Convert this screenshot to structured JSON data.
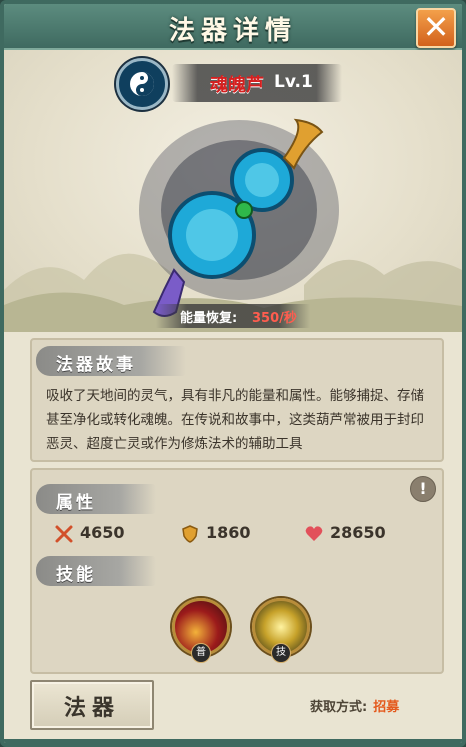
{
  "window": {
    "title": "法器详情",
    "close_icon": "close-icon"
  },
  "item": {
    "name": "魂魄芦",
    "level": "Lv.1",
    "emblem_icon": "yin-yang-icon"
  },
  "energy": {
    "label": "能量恢复:",
    "value": "350/秒"
  },
  "story": {
    "heading": "法器故事",
    "text": "吸收了天地间的灵气，具有非凡的能量和属性。能够捕捉、存储甚至净化或转化魂魄。在传说和故事中，这类葫芦常被用于封印恶灵、超度亡灵或作为修炼法术的辅助工具"
  },
  "attributes": {
    "heading": "属性",
    "info_icon": "!",
    "stats": [
      {
        "icon": "crossed-swords-icon",
        "value": "4650"
      },
      {
        "icon": "shield-icon",
        "value": "1860"
      },
      {
        "icon": "heart-icon",
        "value": "28650"
      }
    ]
  },
  "skills": {
    "heading": "技能",
    "items": [
      {
        "icon": "skill-fire-icon",
        "badge": "普"
      },
      {
        "icon": "skill-lightning-icon",
        "badge": "技"
      }
    ]
  },
  "footer": {
    "button_label": "法器",
    "acquire_label": "获取方式:",
    "acquire_value": "招募"
  },
  "colors": {
    "accent_red": "#d61f1f",
    "acquire_orange": "#e45a1e",
    "frame_green": "#3f6a60"
  }
}
